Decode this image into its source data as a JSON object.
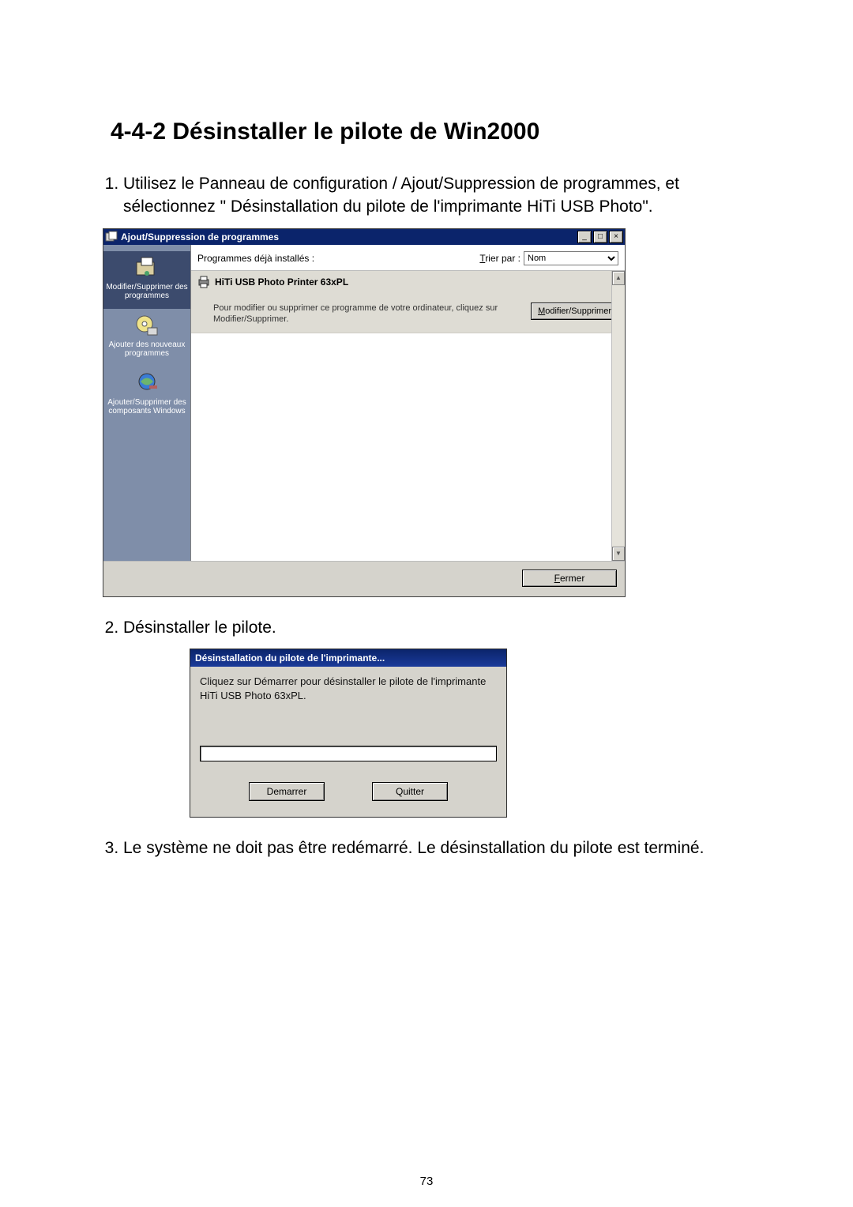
{
  "doc": {
    "heading": "4-4-2 Désinstaller le pilote de Win2000",
    "steps": [
      "Utilisez le Panneau de configuration / Ajout/Suppression de programmes, et sélectionnez \" Désinstallation du pilote de l'imprimante HiTi USB Photo\".",
      "Désinstaller le pilote.",
      "Le système ne doit pas être redémarré. Le désinstallation du pilote est terminé."
    ],
    "page_number": "73"
  },
  "arp": {
    "title": "Ajout/Suppression de programmes",
    "installed_label": "Programmes déjà installés :",
    "sort_prefix": "T",
    "sort_label_rest": "rier par :",
    "sort_value": "Nom",
    "sidebar": [
      {
        "label": "Modifier/Supprimer des programmes",
        "selected": true
      },
      {
        "label": "Ajouter des nouveaux programmes",
        "selected": false
      },
      {
        "label": "Ajouter/Supprimer des composants Windows",
        "selected": false
      }
    ],
    "program": {
      "name": "HiTi USB Photo Printer 63xPL",
      "desc": "Pour modifier ou supprimer ce programme de votre ordinateur, cliquez sur Modifier/Supprimer.",
      "button_prefix": "M",
      "button_rest": "odifier/Supprimer"
    },
    "close_prefix": "F",
    "close_rest": "ermer"
  },
  "dialog": {
    "title": "Désinstallation du pilote de l'imprimante...",
    "body": "Cliquez sur Démarrer pour désinstaller le pilote de l'imprimante HiTi USB Photo 63xPL.",
    "start": "Demarrer",
    "quit": "Quitter"
  }
}
